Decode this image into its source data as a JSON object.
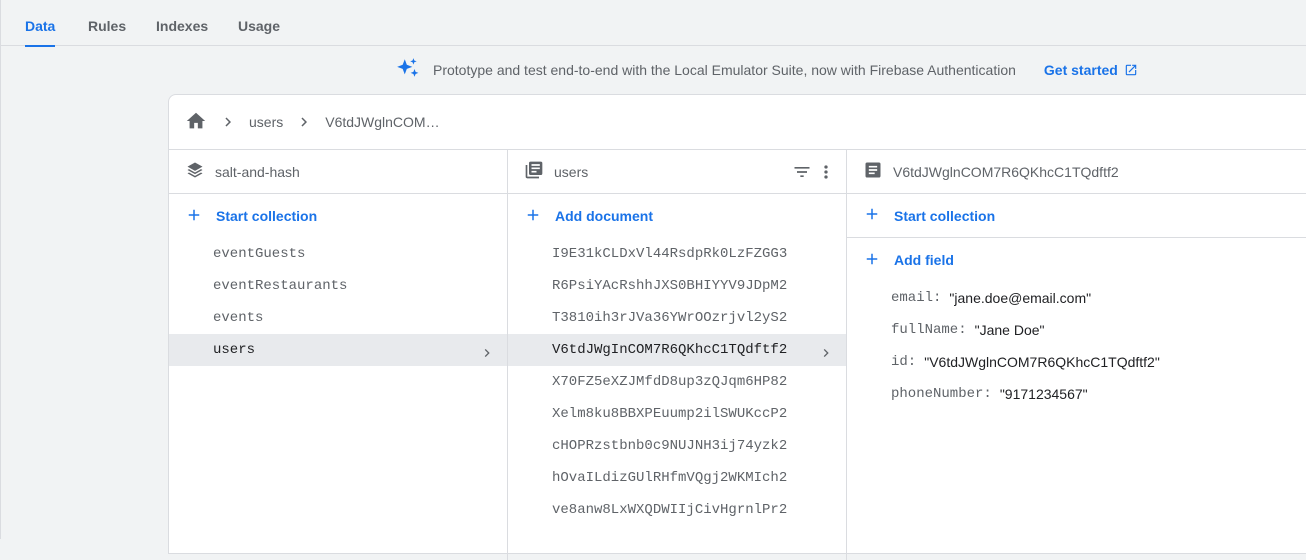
{
  "tabs": [
    "Data",
    "Rules",
    "Indexes",
    "Usage"
  ],
  "banner": {
    "text": "Prototype and test end-to-end with the Local Emulator Suite, now with Firebase Authentication",
    "link": "Get started"
  },
  "breadcrumb": [
    "users",
    "V6tdJWglnCOM…"
  ],
  "root_panel": {
    "title": "salt-and-hash",
    "action": "Start collection",
    "collections": [
      "eventGuests",
      "eventRestaurants",
      "events",
      "users"
    ],
    "selected": "users"
  },
  "collection_panel": {
    "title": "users",
    "action": "Add document",
    "documents": [
      "I9E31kCLDxVl44RsdpRk0LzFZGG3",
      "R6PsiYAcRshhJXS0BHIYYV9JDpM2",
      "T3810ih3rJVa36YWrOOzrjvl2yS2",
      "V6tdJWgInCOM7R6QKhcC1TQdftf2",
      "X70FZ5eXZJMfdD8up3zQJqm6HP82",
      "Xelm8ku8BBXPEuump2ilSWUKccP2",
      "cHOPRzstbnb0c9NUJNH3ij74yzk2",
      "hOvaILdizGUlRHfmVQgj2WKMIch2",
      "ve8anw8LxWXQDWIIjCivHgrnlPr2"
    ],
    "selected": "V6tdJWgInCOM7R6QKhcC1TQdftf2"
  },
  "document_panel": {
    "title": "V6tdJWglnCOM7R6QKhcC1TQdftf2",
    "start_collection": "Start collection",
    "add_field": "Add field",
    "fields": [
      {
        "key": "email:",
        "value": "\"jane.doe@email.com\""
      },
      {
        "key": "fullName:",
        "value": "\"Jane Doe\""
      },
      {
        "key": "id:",
        "value": "\"V6tdJWglnCOM7R6QKhcC1TQdftf2\""
      },
      {
        "key": "phoneNumber:",
        "value": "\"9171234567\""
      }
    ]
  },
  "colors": {
    "accent": "#1a73e8",
    "selected_row": "#e8eaed",
    "border": "#dadce0"
  }
}
